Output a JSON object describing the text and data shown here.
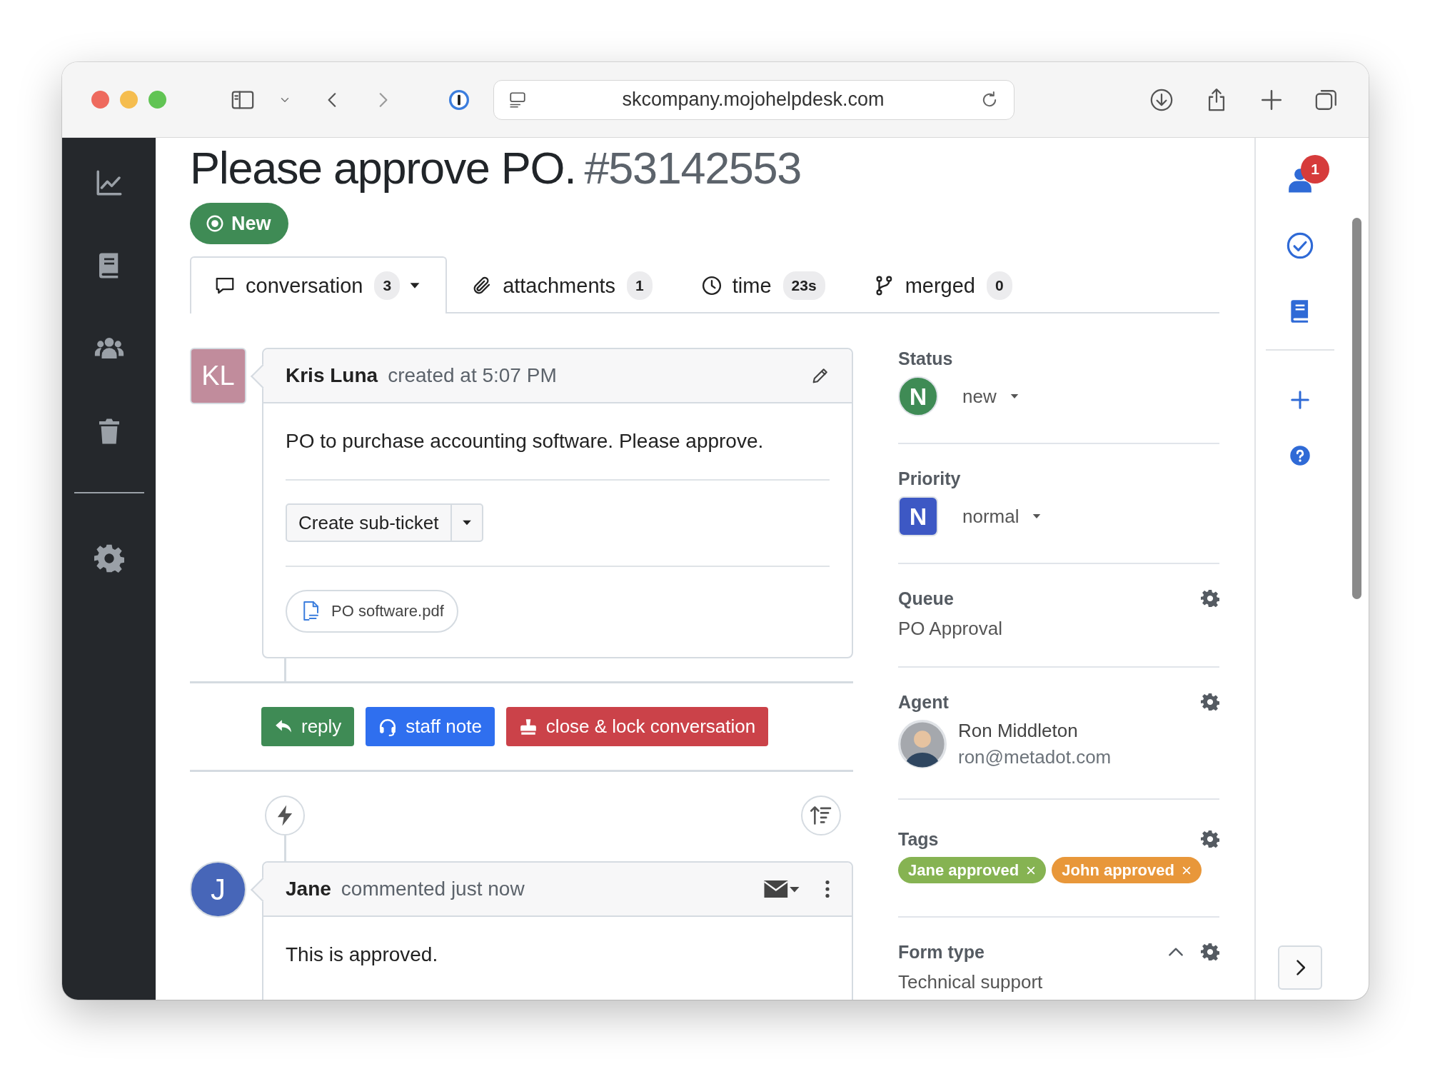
{
  "browser": {
    "url": "skcompany.mojohelpdesk.com"
  },
  "ticket": {
    "title": "Please approve PO.",
    "number": "#53142553",
    "status_badge": "New"
  },
  "tabs": [
    {
      "kind": "conversation",
      "label": "conversation",
      "count": "3",
      "selected": true
    },
    {
      "kind": "attachments",
      "label": "attachments",
      "count": "1",
      "selected": false
    },
    {
      "kind": "time",
      "label": "time",
      "count": "23s",
      "selected": false
    },
    {
      "kind": "merged",
      "label": "merged",
      "count": "0",
      "selected": false
    }
  ],
  "messages": [
    {
      "kind": "created",
      "initials": "KL",
      "color": "#c18c9c",
      "author": "Kris Luna",
      "meta": "created at 5:07 PM",
      "body": "PO to purchase accounting software. Please approve.",
      "sub_ticket": "Create sub-ticket",
      "attachment": "PO software.pdf"
    },
    {
      "kind": "comment",
      "initials": "J",
      "color": "#4766b8",
      "author": "Jane",
      "meta": "commented just now",
      "body": "This is approved."
    }
  ],
  "actions": [
    {
      "kind": "reply",
      "label": "reply"
    },
    {
      "kind": "note",
      "label": "staff note"
    },
    {
      "kind": "close",
      "label": "close & lock conversation"
    }
  ],
  "details": [
    {
      "kind": "status",
      "label": "Status",
      "letter": "N",
      "value": "new"
    },
    {
      "kind": "priority",
      "label": "Priority",
      "letter": "N",
      "value": "normal"
    },
    {
      "kind": "queue",
      "label": "Queue",
      "value": "PO Approval"
    },
    {
      "kind": "agent",
      "label": "Agent",
      "name": "Ron Middleton",
      "email": "ron@metadot.com"
    },
    {
      "kind": "tags",
      "label": "Tags",
      "items": [
        {
          "label": "Jane approved",
          "color": "#86b352"
        },
        {
          "label": "John approved",
          "color": "#e8973a"
        }
      ]
    },
    {
      "kind": "form_type",
      "label": "Form type",
      "value": "Technical support",
      "expanded": true
    }
  ],
  "notifications": {
    "count": "1"
  }
}
